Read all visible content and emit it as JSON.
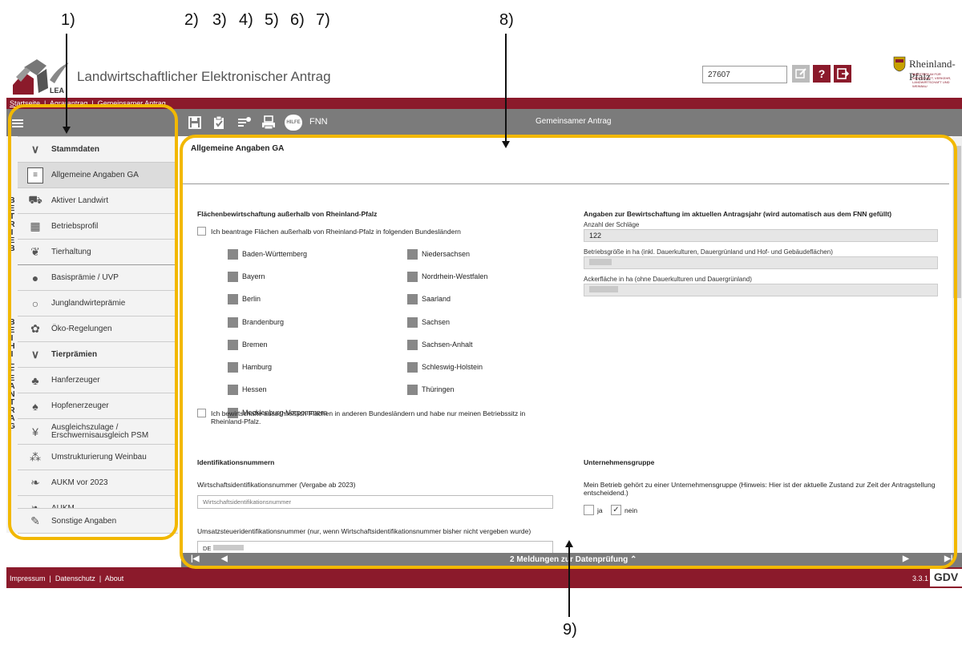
{
  "annotations": [
    "1)",
    "2)",
    "3)",
    "4)",
    "5)",
    "6)",
    "7)",
    "8)",
    "9)"
  ],
  "header": {
    "logo_text": "LEA",
    "app_title": "Landwirtschaftlicher Elektronischer Antrag",
    "user_id": "27607",
    "state_name": "Rheinland-Pfalz",
    "ministry_text": "MINISTERIUM FÜR WIRTSCHAFT, VERKEHR, LANDWIRTSCHAFT UND WEINBAU",
    "help_label": "?",
    "colors": {
      "brand": "#8b1a2b",
      "toolbar": "#7b7b7b",
      "annotation": "#f2b800"
    }
  },
  "breadcrumb": [
    "Startseite",
    "Agrarantrag",
    "Gemeinsamer Antrag"
  ],
  "toolbar": {
    "help_label": "HILFE",
    "fnn_label": "FNN",
    "title": "Gemeinsamer Antrag",
    "icons": [
      "save-icon",
      "clipboard-check-icon",
      "list-edit-icon",
      "print-icon",
      "help-icon"
    ]
  },
  "sidebar": {
    "group1_letters": [
      "B",
      "E",
      "T",
      "R",
      "I",
      "E",
      "B"
    ],
    "group2_letters": [
      "B",
      "E",
      "I",
      "H",
      "I",
      "L",
      "F",
      "E",
      "A",
      "N",
      "T",
      "R",
      "A",
      "G"
    ],
    "items": [
      {
        "label": "Stammdaten",
        "icon": "chevron-down-icon"
      },
      {
        "label": "Allgemeine Angaben GA",
        "icon": "document-icon"
      },
      {
        "label": "Aktiver Landwirt",
        "icon": "tractor-icon"
      },
      {
        "label": "Betriebsprofil",
        "icon": "calendar-icon"
      },
      {
        "label": "Tierhaltung",
        "icon": "paw-icon"
      },
      {
        "label": "Basisprämie / UVP",
        "icon": "piggy-bank-icon"
      },
      {
        "label": "Junglandwirteprämie",
        "icon": "person-icon"
      },
      {
        "label": "Öko-Regelungen",
        "icon": "flower-icon"
      },
      {
        "label": "Tierprämien",
        "icon": "chevron-down-icon"
      },
      {
        "label": "Hanferzeuger",
        "icon": "club-icon"
      },
      {
        "label": "Hopfenerzeuger",
        "icon": "spade-icon"
      },
      {
        "label": "Ausgleichszulage / Erschwernisausgleich PSM",
        "icon": "wheat-icon"
      },
      {
        "label": "Umstrukturierung Weinbau",
        "icon": "grapes-icon"
      },
      {
        "label": "AUKM vor 2023",
        "icon": "leaf-icon"
      },
      {
        "label": "AUKM",
        "icon": "leaf-icon"
      },
      {
        "label": "Sonstige Angaben",
        "icon": "pen-icon"
      }
    ]
  },
  "main": {
    "title": "Allgemeine Angaben GA",
    "section_outside": "Flächenbewirtschaftung außerhalb von Rheinland-Pfalz",
    "checkbox_outside": "Ich beantrage Flächen außerhalb von Rheinland-Pfalz in folgenden Bundesländern",
    "states_left": [
      "Baden-Württemberg",
      "Bayern",
      "Berlin",
      "Brandenburg",
      "Bremen",
      "Hamburg",
      "Hessen",
      "Mecklenburg-Vorpommern"
    ],
    "states_right": [
      "Niedersachsen",
      "Nordrhein-Westfalen",
      "Saarland",
      "Sachsen",
      "Sachsen-Anhalt",
      "Schleswig-Holstein",
      "Thüringen"
    ],
    "checkbox_exclusive": "Ich bewirtschafte ausschließlich Flächen in anderen Bundesländern und habe nur meinen Betriebssitz in Rheinland-Pfalz.",
    "section_current": "Angaben zur Bewirtschaftung im aktuellen Antragsjahr (wird automatisch aus dem FNN gefüllt)",
    "label_schlaege": "Anzahl der Schläge",
    "value_schlaege": "122",
    "label_betriebsgroesse": "Betriebsgröße in ha (inkl. Dauerkulturen, Dauergrünland und Hof- und Gebäudeflächen)",
    "label_ackerflaeche": "Ackerfläche in ha (ohne Dauerkulturen und Dauergrünland)",
    "section_ident": "Identifikationsnummern",
    "label_wirtschafts_id": "Wirtschaftsidentifikationsnummer (Vergabe ab 2023)",
    "placeholder_wirtschafts_id": "Wirtschaftsidentifikationsnummer",
    "label_ust_id": "Umsatzsteueridentifikationsnummer (nur, wenn Wirtschaftsidentifikationsnummer bisher nicht vergeben wurde)",
    "ust_prefix": "DE",
    "section_group": "Unternehmensgruppe",
    "group_text": "Mein Betrieb gehört zu einer Unternehmensgruppe (Hinweis: Hier ist der aktuelle Zustand zur Zeit der Antragstellung entscheidend.)",
    "option_ja": "ja",
    "option_nein": "nein",
    "nein_checked": true
  },
  "pager": {
    "messages": "2 Meldungen zur Datenprüfung"
  },
  "footer": {
    "links": [
      "Impressum",
      "Datenschutz",
      "About"
    ],
    "version": "3.3.1",
    "logo": "GDV"
  }
}
